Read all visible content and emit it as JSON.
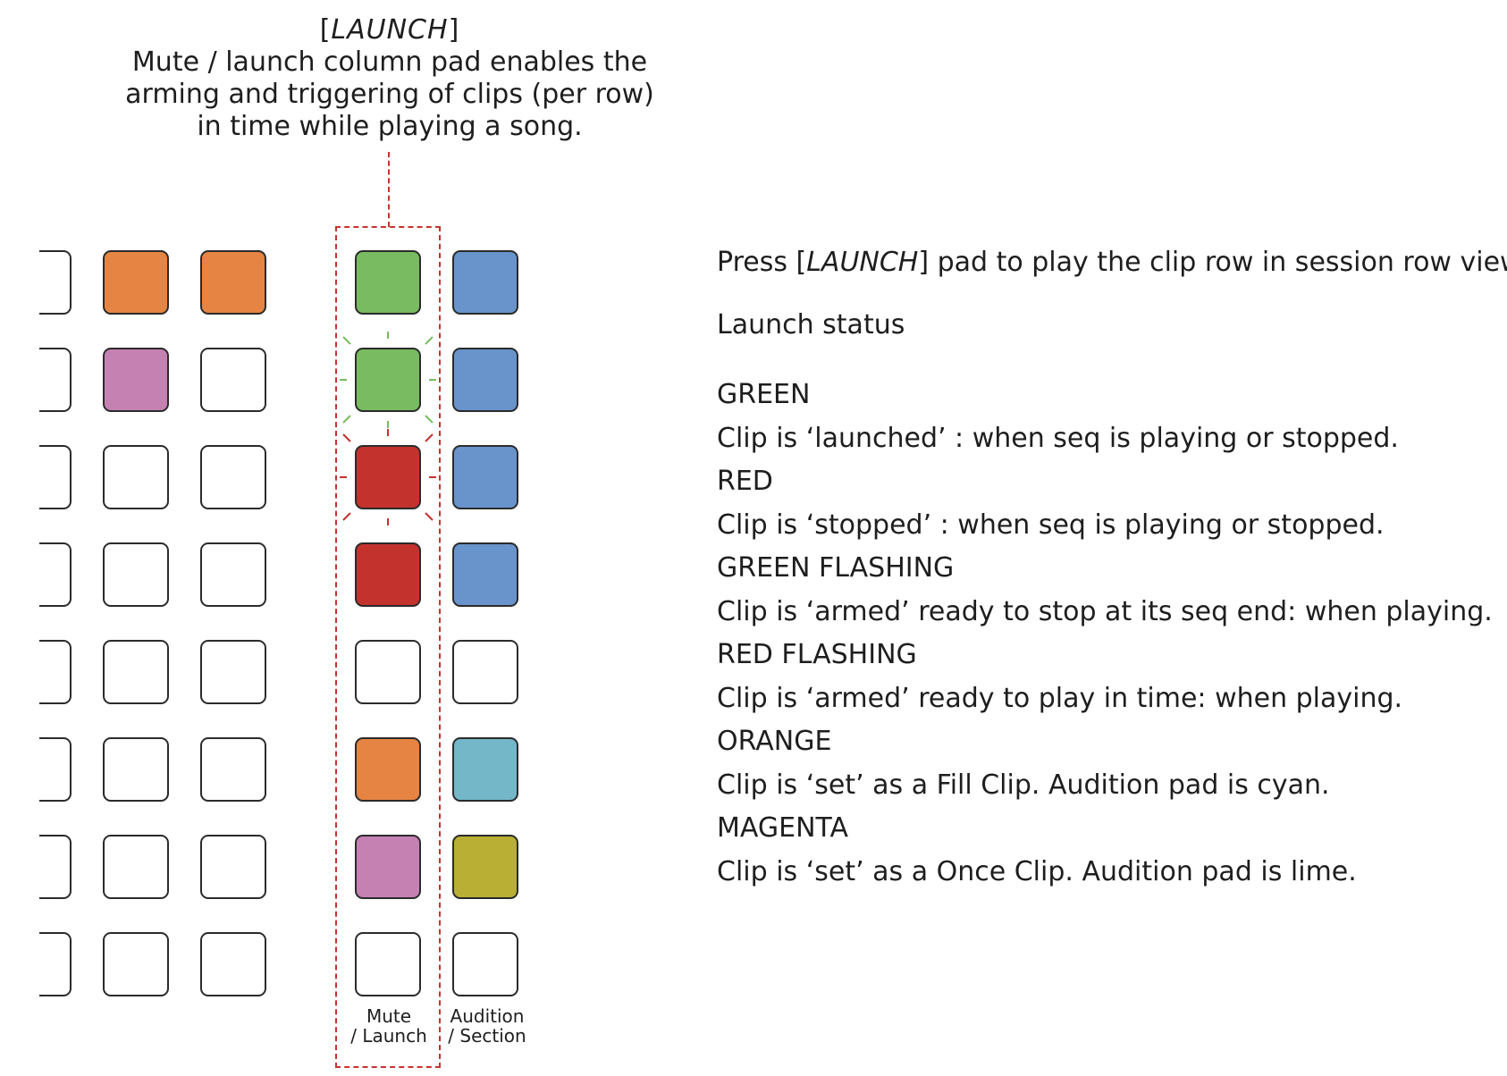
{
  "callout": {
    "key_open": "[",
    "key": "LAUNCH",
    "key_close": "]",
    "lines": [
      "Mute / launch column pad enables the",
      "arming and triggering of clips (per row)",
      "in time while playing a song."
    ]
  },
  "colors": {
    "orange": "#e68443",
    "magenta": "#c681b3",
    "green": "#78bb60",
    "red": "#c4322e",
    "blue": "#6894cb",
    "cyan": "#74b7c9",
    "lime": "#b8af34",
    "empty": "#ffffff",
    "guide": "#c8332e"
  },
  "grid": {
    "clip_col_a": [
      "empty",
      "empty",
      "empty",
      "empty",
      "empty",
      "empty",
      "empty",
      "empty"
    ],
    "clip_col_b": [
      "orange",
      "magenta",
      "empty",
      "empty",
      "empty",
      "empty",
      "empty",
      "empty"
    ],
    "clip_col_c": [
      "orange",
      "empty",
      "empty",
      "empty",
      "empty",
      "empty",
      "empty",
      "empty"
    ],
    "launch_col": [
      "green",
      "green",
      "red",
      "red",
      "empty",
      "orange",
      "magenta",
      "empty"
    ],
    "launch_flashing": [
      false,
      true,
      true,
      false,
      false,
      false,
      false,
      false
    ],
    "audition_col": [
      "blue",
      "blue",
      "blue",
      "blue",
      "empty",
      "cyan",
      "lime",
      "empty"
    ]
  },
  "labels": {
    "launch_col": [
      "Mute",
      "/ Launch"
    ],
    "audition_col": [
      "Audition",
      "/ Section"
    ]
  },
  "info": {
    "intro_pre": "Press [",
    "intro_key": "LAUNCH",
    "intro_post": "] pad to play the clip row in session row view.",
    "status_title": "Launch status",
    "statuses": [
      {
        "name": "GREEN",
        "desc": "Clip is ‘launched’ : when seq is playing or stopped."
      },
      {
        "name": "RED",
        "desc": "Clip is ‘stopped’ : when seq is playing or stopped."
      },
      {
        "name": "GREEN FLASHING",
        "desc": "Clip is ‘armed’ ready to stop at its seq end: when playing."
      },
      {
        "name": "RED FLASHING",
        "desc": "Clip is ‘armed’ ready to play in time: when playing."
      },
      {
        "name": "ORANGE",
        "desc": "Clip is ‘set’ as a Fill Clip. Audition pad is cyan."
      },
      {
        "name": "MAGENTA",
        "desc": "Clip is ‘set’ as a Once Clip. Audition pad is lime."
      }
    ]
  }
}
